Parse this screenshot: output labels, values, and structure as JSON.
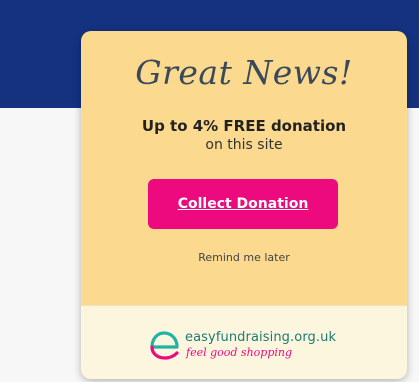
{
  "popup": {
    "headline": "Great News!",
    "offer_line": "Up to 4% FREE donation",
    "offer_subline": "on this site",
    "collect_button_label": "Collect Donation",
    "remind_link_label": "Remind me later"
  },
  "brand": {
    "name": "easyfundraising.org.uk",
    "tagline": "feel good shopping",
    "logo_icon": "easyfundraising-e-icon"
  },
  "colors": {
    "header": "#143280",
    "popup_background": "#fbd98e",
    "footer_background": "#fdf6df",
    "button": "#ec0a7e",
    "brand_teal": "#1c7a72",
    "brand_pink": "#ec0a7e"
  }
}
